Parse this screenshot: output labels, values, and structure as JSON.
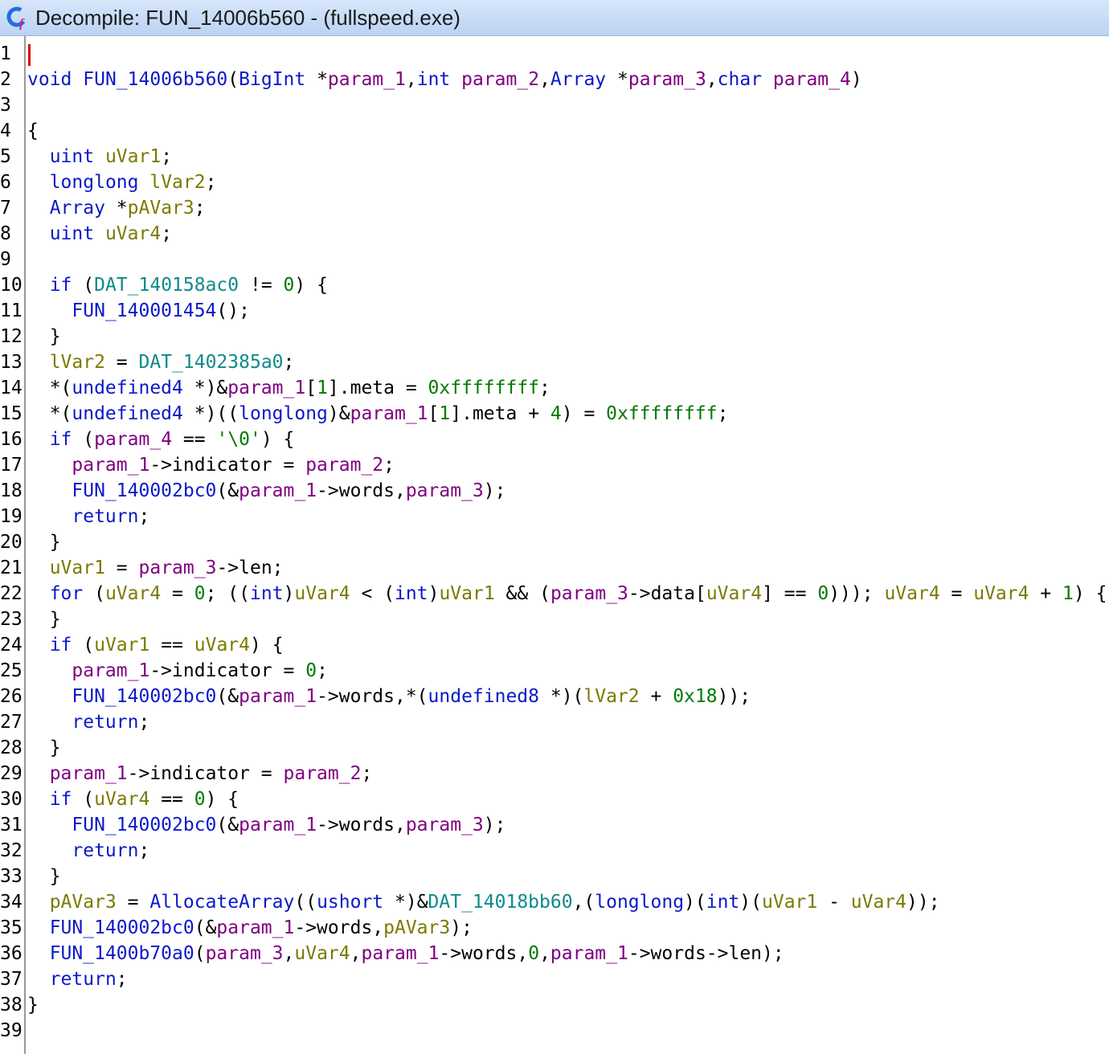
{
  "window": {
    "title": "Decompile: FUN_14006b560 -  (fullspeed.exe)",
    "icon": "decompiler-c-icon"
  },
  "colors": {
    "keyword": "#0b19c9",
    "function": "#0b19c9",
    "param": "#800080",
    "local": "#7a7a00",
    "global": "#0e8a8a",
    "number": "#007a00"
  },
  "code_lines": [
    [],
    [
      [
        "kw",
        "void"
      ],
      [
        "pu",
        " "
      ],
      [
        "fn",
        "FUN_14006b560"
      ],
      [
        "pu",
        "("
      ],
      [
        "ty",
        "BigInt"
      ],
      [
        "pu",
        " *"
      ],
      [
        "pr",
        "param_1"
      ],
      [
        "pu",
        ","
      ],
      [
        "ty",
        "int"
      ],
      [
        "pu",
        " "
      ],
      [
        "pr",
        "param_2"
      ],
      [
        "pu",
        ","
      ],
      [
        "ty",
        "Array"
      ],
      [
        "pu",
        " *"
      ],
      [
        "pr",
        "param_3"
      ],
      [
        "pu",
        ","
      ],
      [
        "ty",
        "char"
      ],
      [
        "pu",
        " "
      ],
      [
        "pr",
        "param_4"
      ],
      [
        "pu",
        ")"
      ]
    ],
    [],
    [
      [
        "pu",
        "{"
      ]
    ],
    [
      [
        "pu",
        "  "
      ],
      [
        "ty",
        "uint"
      ],
      [
        "pu",
        " "
      ],
      [
        "lv",
        "uVar1"
      ],
      [
        "pu",
        ";"
      ]
    ],
    [
      [
        "pu",
        "  "
      ],
      [
        "ty",
        "longlong"
      ],
      [
        "pu",
        " "
      ],
      [
        "lv",
        "lVar2"
      ],
      [
        "pu",
        ";"
      ]
    ],
    [
      [
        "pu",
        "  "
      ],
      [
        "ty",
        "Array"
      ],
      [
        "pu",
        " *"
      ],
      [
        "lv",
        "pAVar3"
      ],
      [
        "pu",
        ";"
      ]
    ],
    [
      [
        "pu",
        "  "
      ],
      [
        "ty",
        "uint"
      ],
      [
        "pu",
        " "
      ],
      [
        "lv",
        "uVar4"
      ],
      [
        "pu",
        ";"
      ]
    ],
    [],
    [
      [
        "pu",
        "  "
      ],
      [
        "kw",
        "if"
      ],
      [
        "pu",
        " ("
      ],
      [
        "gv",
        "DAT_140158ac0"
      ],
      [
        "pu",
        " != "
      ],
      [
        "nm",
        "0"
      ],
      [
        "pu",
        ") {"
      ]
    ],
    [
      [
        "pu",
        "    "
      ],
      [
        "fn",
        "FUN_140001454"
      ],
      [
        "pu",
        "();"
      ]
    ],
    [
      [
        "pu",
        "  }"
      ]
    ],
    [
      [
        "pu",
        "  "
      ],
      [
        "lv",
        "lVar2"
      ],
      [
        "pu",
        " = "
      ],
      [
        "gv",
        "DAT_1402385a0"
      ],
      [
        "pu",
        ";"
      ]
    ],
    [
      [
        "pu",
        "  *("
      ],
      [
        "ty",
        "undefined4"
      ],
      [
        "pu",
        " *)&"
      ],
      [
        "pr",
        "param_1"
      ],
      [
        "pu",
        "["
      ],
      [
        "nm",
        "1"
      ],
      [
        "pu",
        "].meta = "
      ],
      [
        "nm",
        "0xffffffff"
      ],
      [
        "pu",
        ";"
      ]
    ],
    [
      [
        "pu",
        "  *("
      ],
      [
        "ty",
        "undefined4"
      ],
      [
        "pu",
        " *)(("
      ],
      [
        "ty",
        "longlong"
      ],
      [
        "pu",
        ")&"
      ],
      [
        "pr",
        "param_1"
      ],
      [
        "pu",
        "["
      ],
      [
        "nm",
        "1"
      ],
      [
        "pu",
        "].meta + "
      ],
      [
        "nm",
        "4"
      ],
      [
        "pu",
        ") = "
      ],
      [
        "nm",
        "0xffffffff"
      ],
      [
        "pu",
        ";"
      ]
    ],
    [
      [
        "pu",
        "  "
      ],
      [
        "kw",
        "if"
      ],
      [
        "pu",
        " ("
      ],
      [
        "pr",
        "param_4"
      ],
      [
        "pu",
        " == "
      ],
      [
        "nm",
        "'\\0'"
      ],
      [
        "pu",
        ") {"
      ]
    ],
    [
      [
        "pu",
        "    "
      ],
      [
        "pr",
        "param_1"
      ],
      [
        "pu",
        "->indicator = "
      ],
      [
        "pr",
        "param_2"
      ],
      [
        "pu",
        ";"
      ]
    ],
    [
      [
        "pu",
        "    "
      ],
      [
        "fn",
        "FUN_140002bc0"
      ],
      [
        "pu",
        "(&"
      ],
      [
        "pr",
        "param_1"
      ],
      [
        "pu",
        "->words,"
      ],
      [
        "pr",
        "param_3"
      ],
      [
        "pu",
        ");"
      ]
    ],
    [
      [
        "pu",
        "    "
      ],
      [
        "kw",
        "return"
      ],
      [
        "pu",
        ";"
      ]
    ],
    [
      [
        "pu",
        "  }"
      ]
    ],
    [
      [
        "pu",
        "  "
      ],
      [
        "lv",
        "uVar1"
      ],
      [
        "pu",
        " = "
      ],
      [
        "pr",
        "param_3"
      ],
      [
        "pu",
        "->len;"
      ]
    ],
    [
      [
        "pu",
        "  "
      ],
      [
        "kw",
        "for"
      ],
      [
        "pu",
        " ("
      ],
      [
        "lv",
        "uVar4"
      ],
      [
        "pu",
        " = "
      ],
      [
        "nm",
        "0"
      ],
      [
        "pu",
        "; (("
      ],
      [
        "ty",
        "int"
      ],
      [
        "pu",
        ")"
      ],
      [
        "lv",
        "uVar4"
      ],
      [
        "pu",
        " < ("
      ],
      [
        "ty",
        "int"
      ],
      [
        "pu",
        ")"
      ],
      [
        "lv",
        "uVar1"
      ],
      [
        "pu",
        " && ("
      ],
      [
        "pr",
        "param_3"
      ],
      [
        "pu",
        "->data["
      ],
      [
        "lv",
        "uVar4"
      ],
      [
        "pu",
        "] == "
      ],
      [
        "nm",
        "0"
      ],
      [
        "pu",
        "))); "
      ],
      [
        "lv",
        "uVar4"
      ],
      [
        "pu",
        " = "
      ],
      [
        "lv",
        "uVar4"
      ],
      [
        "pu",
        " + "
      ],
      [
        "nm",
        "1"
      ],
      [
        "pu",
        ") {"
      ]
    ],
    [
      [
        "pu",
        "  }"
      ]
    ],
    [
      [
        "pu",
        "  "
      ],
      [
        "kw",
        "if"
      ],
      [
        "pu",
        " ("
      ],
      [
        "lv",
        "uVar1"
      ],
      [
        "pu",
        " == "
      ],
      [
        "lv",
        "uVar4"
      ],
      [
        "pu",
        ") {"
      ]
    ],
    [
      [
        "pu",
        "    "
      ],
      [
        "pr",
        "param_1"
      ],
      [
        "pu",
        "->indicator = "
      ],
      [
        "nm",
        "0"
      ],
      [
        "pu",
        ";"
      ]
    ],
    [
      [
        "pu",
        "    "
      ],
      [
        "fn",
        "FUN_140002bc0"
      ],
      [
        "pu",
        "(&"
      ],
      [
        "pr",
        "param_1"
      ],
      [
        "pu",
        "->words,*("
      ],
      [
        "ty",
        "undefined8"
      ],
      [
        "pu",
        " *)("
      ],
      [
        "lv",
        "lVar2"
      ],
      [
        "pu",
        " + "
      ],
      [
        "nm",
        "0x18"
      ],
      [
        "pu",
        "));"
      ]
    ],
    [
      [
        "pu",
        "    "
      ],
      [
        "kw",
        "return"
      ],
      [
        "pu",
        ";"
      ]
    ],
    [
      [
        "pu",
        "  }"
      ]
    ],
    [
      [
        "pu",
        "  "
      ],
      [
        "pr",
        "param_1"
      ],
      [
        "pu",
        "->indicator = "
      ],
      [
        "pr",
        "param_2"
      ],
      [
        "pu",
        ";"
      ]
    ],
    [
      [
        "pu",
        "  "
      ],
      [
        "kw",
        "if"
      ],
      [
        "pu",
        " ("
      ],
      [
        "lv",
        "uVar4"
      ],
      [
        "pu",
        " == "
      ],
      [
        "nm",
        "0"
      ],
      [
        "pu",
        ") {"
      ]
    ],
    [
      [
        "pu",
        "    "
      ],
      [
        "fn",
        "FUN_140002bc0"
      ],
      [
        "pu",
        "(&"
      ],
      [
        "pr",
        "param_1"
      ],
      [
        "pu",
        "->words,"
      ],
      [
        "pr",
        "param_3"
      ],
      [
        "pu",
        ");"
      ]
    ],
    [
      [
        "pu",
        "    "
      ],
      [
        "kw",
        "return"
      ],
      [
        "pu",
        ";"
      ]
    ],
    [
      [
        "pu",
        "  }"
      ]
    ],
    [
      [
        "pu",
        "  "
      ],
      [
        "lv",
        "pAVar3"
      ],
      [
        "pu",
        " = "
      ],
      [
        "fn",
        "AllocateArray"
      ],
      [
        "pu",
        "(("
      ],
      [
        "ty",
        "ushort"
      ],
      [
        "pu",
        " *)&"
      ],
      [
        "gv",
        "DAT_14018bb60"
      ],
      [
        "pu",
        ",("
      ],
      [
        "ty",
        "longlong"
      ],
      [
        "pu",
        ")("
      ],
      [
        "ty",
        "int"
      ],
      [
        "pu",
        ")("
      ],
      [
        "lv",
        "uVar1"
      ],
      [
        "pu",
        " - "
      ],
      [
        "lv",
        "uVar4"
      ],
      [
        "pu",
        "));"
      ]
    ],
    [
      [
        "pu",
        "  "
      ],
      [
        "fn",
        "FUN_140002bc0"
      ],
      [
        "pu",
        "(&"
      ],
      [
        "pr",
        "param_1"
      ],
      [
        "pu",
        "->words,"
      ],
      [
        "lv",
        "pAVar3"
      ],
      [
        "pu",
        ");"
      ]
    ],
    [
      [
        "pu",
        "  "
      ],
      [
        "fn",
        "FUN_1400b70a0"
      ],
      [
        "pu",
        "("
      ],
      [
        "pr",
        "param_3"
      ],
      [
        "pu",
        ","
      ],
      [
        "lv",
        "uVar4"
      ],
      [
        "pu",
        ","
      ],
      [
        "pr",
        "param_1"
      ],
      [
        "pu",
        "->words,"
      ],
      [
        "nm",
        "0"
      ],
      [
        "pu",
        ","
      ],
      [
        "pr",
        "param_1"
      ],
      [
        "pu",
        "->words->len);"
      ]
    ],
    [
      [
        "pu",
        "  "
      ],
      [
        "kw",
        "return"
      ],
      [
        "pu",
        ";"
      ]
    ],
    [
      [
        "pu",
        "}"
      ]
    ],
    []
  ]
}
